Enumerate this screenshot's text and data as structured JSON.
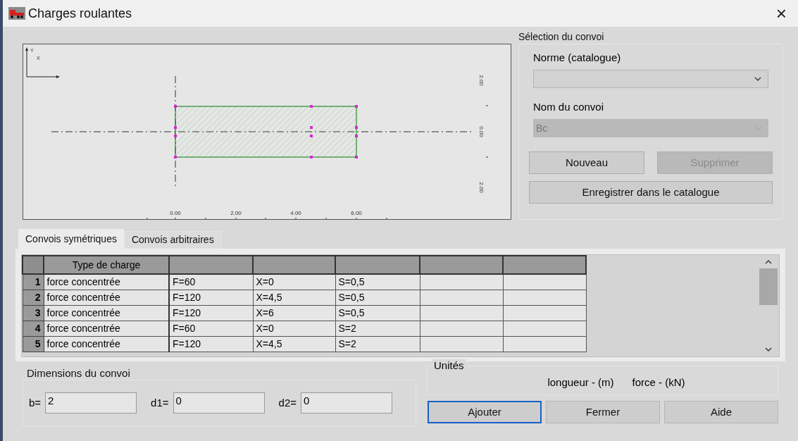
{
  "window": {
    "title": "Charges roulantes",
    "close": "×"
  },
  "drawing": {
    "axis_labels": [
      "Y",
      "X"
    ],
    "x_labels": [
      "0.00",
      "2.00",
      "4.00",
      "6.00"
    ],
    "y_labels": [
      "2.00",
      "0.00",
      "2.00"
    ]
  },
  "selection": {
    "title": "Sélection du convoi",
    "norme": {
      "label": "Norme (catalogue)",
      "disabled": false
    },
    "nom": {
      "label": "Nom du convoi",
      "value": "Bc",
      "disabled": true
    },
    "buttons": [
      {
        "label": "Nouveau",
        "disabled": false
      },
      {
        "label": "Supprimer",
        "disabled": true
      }
    ],
    "save_button": {
      "label": "Enregistrer dans le catalogue",
      "disabled": false
    }
  },
  "tabs": [
    {
      "label": "Convois symétriques",
      "selected": true
    },
    {
      "label": "Convois arbitraires",
      "selected": false
    }
  ],
  "table": {
    "columns": [
      "Type de charge"
    ],
    "rows": [
      {
        "number": "1",
        "cells": [
          "force concentrée",
          "F=60",
          "X=0",
          "S=0,5"
        ]
      },
      {
        "number": "2",
        "cells": [
          "force concentrée",
          "F=120",
          "X=4,5",
          "S=0,5"
        ]
      },
      {
        "number": "3",
        "cells": [
          "force concentrée",
          "F=120",
          "X=6",
          "S=0,5"
        ]
      },
      {
        "number": "4",
        "cells": [
          "force concentrée",
          "F=60",
          "X=0",
          "S=2"
        ]
      },
      {
        "number": "5",
        "cells": [
          "force concentrée",
          "F=120",
          "X=4,5",
          "S=2"
        ]
      }
    ]
  },
  "dimensions": {
    "title": "Dimensions du convoi",
    "fields": [
      {
        "label": "b=",
        "value": "2"
      },
      {
        "label": "d1=",
        "value": "0"
      },
      {
        "label": "d2=",
        "value": "0"
      }
    ]
  },
  "units": {
    "title": "Unités",
    "texts": [
      "longueur - (m)",
      "force - (kN)"
    ]
  },
  "buttons": [
    {
      "label": "Ajouter",
      "focused": true
    },
    {
      "label": "Fermer",
      "focused": false
    },
    {
      "label": "Aide",
      "focused": false
    }
  ]
}
